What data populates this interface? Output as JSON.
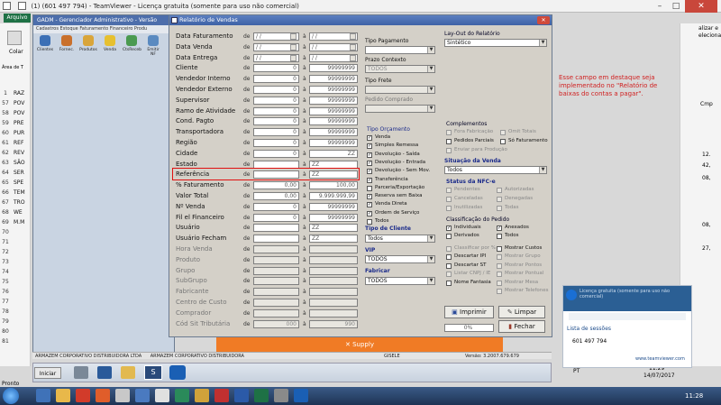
{
  "teamviewer_title": "(1) (601 497 794) - TeamViewer - Licença gratuita (somente para uso não comercial)",
  "excel": {
    "tab": "Arquivo",
    "left_labels": [
      "Colar",
      "Área de T"
    ],
    "row_numbers": [
      "1",
      "57",
      "58",
      "59",
      "60",
      "61",
      "62",
      "63",
      "64",
      "65",
      "66",
      "67",
      "68",
      "69",
      "70",
      "71",
      "72",
      "73",
      "74",
      "75",
      "76",
      "77",
      "78",
      "79",
      "80",
      "81"
    ],
    "row_texts": [
      "RAZ",
      "POV",
      "POV",
      "PRE",
      "PUR",
      "REF",
      "REV",
      "SÃO",
      "SER",
      "SPE",
      "TEM",
      "TRO",
      "WE",
      "M.M"
    ],
    "right_labels": [
      "alizar e",
      "elecionar",
      "Cmp",
      "12.",
      "42,",
      "08,",
      "08,",
      "27,"
    ],
    "status": "Pronto"
  },
  "gadm": {
    "title": "GADM - Gerenciador Administrativo - Versão",
    "menu": "Cadastros  Estoque  Faturamento  Financeiro  Produ",
    "tools": [
      "Clientes",
      "Fornec.",
      "Produtos",
      "Venda",
      "CtsReceb",
      "Emitir NF"
    ],
    "status_company": "ARMAZEM CORPORATIVO DISTRIBUIDORA LTDA",
    "status_branch": "ARMAZEM CORPORATIVO DISTRIBUIDORA",
    "status_user": "GISELE",
    "status_version": "Versão: 3.2007.679.679"
  },
  "dialog": {
    "title": "Relatório de Vendas",
    "de": "de",
    "ate": "à",
    "filters": [
      {
        "label": "Data Faturamento",
        "from": "/ /",
        "to": "/ /",
        "type": "date",
        "enabled": true
      },
      {
        "label": "Data Venda",
        "from": "/ /",
        "to": "/ /",
        "type": "date",
        "enabled": true
      },
      {
        "label": "Data Entrega",
        "from": "/ /",
        "to": "/ /",
        "type": "date",
        "enabled": true
      },
      {
        "label": "Cliente",
        "from": "0",
        "to": "99999999",
        "type": "num",
        "enabled": true
      },
      {
        "label": "Vendedor Interno",
        "from": "0",
        "to": "99999999",
        "type": "num",
        "enabled": true
      },
      {
        "label": "Vendedor Externo",
        "from": "0",
        "to": "99999999",
        "type": "num",
        "enabled": true
      },
      {
        "label": "Supervisor",
        "from": "0",
        "to": "99999999",
        "type": "num",
        "enabled": true
      },
      {
        "label": "Ramo de Atividade",
        "from": "0",
        "to": "99999999",
        "type": "num",
        "enabled": true
      },
      {
        "label": "Cond. Pagto",
        "from": "0",
        "to": "99999999",
        "type": "num",
        "enabled": true
      },
      {
        "label": "Transportadora",
        "from": "0",
        "to": "99999999",
        "type": "num",
        "enabled": true
      },
      {
        "label": "Região",
        "from": "0",
        "to": "99999999",
        "type": "num",
        "enabled": true
      },
      {
        "label": "Cidade",
        "from": "0",
        "to": "ZZ",
        "type": "num",
        "enabled": true
      },
      {
        "label": "Estado",
        "from": "",
        "to": "ZZ",
        "type": "text",
        "enabled": true
      },
      {
        "label": "Referência",
        "from": "",
        "to": "ZZ",
        "type": "text",
        "enabled": true
      },
      {
        "label": "% Faturamento",
        "from": "0,00",
        "to": "100,00",
        "type": "num",
        "enabled": true
      },
      {
        "label": "Valor Total",
        "from": "0,00",
        "to": "9.999.999,99",
        "type": "num",
        "enabled": true
      },
      {
        "label": "Nº Venda",
        "from": "0",
        "to": "99999999",
        "type": "num",
        "enabled": true
      },
      {
        "label": "Fil el Financeiro",
        "from": "0",
        "to": "99999999",
        "type": "num",
        "enabled": true
      },
      {
        "label": "Usuário",
        "from": "",
        "to": "ZZ",
        "type": "text",
        "enabled": true
      },
      {
        "label": "Usuário Fecham",
        "from": "",
        "to": "ZZ",
        "type": "text",
        "enabled": true
      },
      {
        "label": "Hora Venda",
        "from": "",
        "to": "",
        "type": "text",
        "enabled": false
      },
      {
        "label": "Produto",
        "from": "",
        "to": "",
        "type": "num",
        "enabled": false
      },
      {
        "label": "Grupo",
        "from": "",
        "to": "",
        "type": "num",
        "enabled": false
      },
      {
        "label": "SubGrupo",
        "from": "",
        "to": "",
        "type": "num",
        "enabled": false
      },
      {
        "label": "Fabricante",
        "from": "",
        "to": "",
        "type": "num",
        "enabled": false
      },
      {
        "label": "Centro de Custo",
        "from": "",
        "to": "",
        "type": "num",
        "enabled": false
      },
      {
        "label": "Comprador",
        "from": "",
        "to": "",
        "type": "num",
        "enabled": false
      },
      {
        "label": "Cód Sit Tributária",
        "from": "000",
        "to": "990",
        "type": "num",
        "enabled": false
      }
    ],
    "mid": {
      "tipo_pagamento_label": "Tipo Pagamento",
      "prazo_label": "Prazo Contexto",
      "prazo_value": "TODOS",
      "tipo_frete_label": "Tipo Frete",
      "pedido_label": "Pedido Comprado",
      "tipo_orcamento_label": "Tipo Orçamento",
      "tipo_items": [
        {
          "label": "Venda",
          "checked": true
        },
        {
          "label": "Simples Remessa",
          "checked": true
        },
        {
          "label": "Devolução - Saída",
          "checked": true
        },
        {
          "label": "Devolução - Entrada",
          "checked": true
        },
        {
          "label": "Devolução - Sem Mov.",
          "checked": true
        },
        {
          "label": "Transferência",
          "checked": true
        },
        {
          "label": "Parceria/Exportação",
          "checked": false
        },
        {
          "label": "Reserva sem Baixa",
          "checked": true
        },
        {
          "label": "Venda Direta",
          "checked": true
        },
        {
          "label": "Ordem de Serviço",
          "checked": true
        },
        {
          "label": "Todos",
          "checked": false
        }
      ],
      "tipo_cliente_label": "Tipo de Cliente",
      "tipo_cliente_value": "Todos",
      "vip_label": "VIP",
      "vip_value": "TODOS",
      "fabricar_label": "Fabricar",
      "fabricar_value": "TODOS"
    },
    "right": {
      "layout_label": "Lay-Out do Relatório",
      "layout_value": "Sintético",
      "complementos_label": "Complementos",
      "complementos": [
        {
          "label": "Fora Fabricação",
          "checked": false,
          "enabled": false
        },
        {
          "label": "Omit Totais",
          "checked": false,
          "enabled": false
        },
        {
          "label": "Pedidos Parciais",
          "checked": false,
          "enabled": true
        },
        {
          "label": "Só Faturamento",
          "checked": false,
          "enabled": true
        },
        {
          "label": "Enviar para Produção",
          "checked": false,
          "enabled": false
        }
      ],
      "situacao_label": "Situação da Venda",
      "situacao_value": "Todos",
      "nfce_label": "Status da NFC-e",
      "nfce_items": [
        {
          "label": "Pendentes",
          "checked": false
        },
        {
          "label": "Autorizadas",
          "checked": false
        },
        {
          "label": "Canceladas",
          "checked": false
        },
        {
          "label": "Denegadas",
          "checked": false
        },
        {
          "label": "Inutilizadas",
          "checked": false
        },
        {
          "label": "Todas",
          "checked": false
        }
      ],
      "classif_label": "Classificação do Pedido",
      "classif_items": [
        {
          "label": "Individuais",
          "checked": true
        },
        {
          "label": "Anexados",
          "checked": true
        },
        {
          "label": "Derivados",
          "checked": false
        },
        {
          "label": "Todos",
          "checked": false
        }
      ],
      "opts_left": [
        {
          "label": "Classificar por %",
          "checked": false,
          "enabled": false
        },
        {
          "label": "Descartar IPI",
          "checked": false,
          "enabled": true
        },
        {
          "label": "Descartar ST",
          "checked": false,
          "enabled": true
        },
        {
          "label": "Listar CNPJ / IE",
          "checked": false,
          "enabled": false
        },
        {
          "label": "Nome Fantasia",
          "checked": false,
          "enabled": true
        }
      ],
      "opts_right": [
        {
          "label": "Mostrar Custos",
          "checked": false,
          "enabled": true
        },
        {
          "label": "Mostrar Grupo",
          "checked": false,
          "enabled": false
        },
        {
          "label": "Mostrar Pontos",
          "checked": false,
          "enabled": false
        },
        {
          "label": "Mostrar Pontual",
          "checked": false,
          "enabled": false
        },
        {
          "label": "Mostrar Mesa",
          "checked": false,
          "enabled": false
        },
        {
          "label": "Mostrar Telefones",
          "checked": false,
          "enabled": false
        }
      ],
      "imprimir_label": "Imprimir",
      "limpar_label": "Limpar",
      "progress_label": "0%",
      "progress_value": 0,
      "fechar_label": "Fechar"
    }
  },
  "note": "Esse campo em destaque seja implementado no \"Relatório de baixas do contas a pagar\".",
  "supply_text": "Supply",
  "teamviewer_panel": {
    "notif": "Licença gratuita (somente para uso não comercial)",
    "list_title": "Lista de sessões",
    "session_id": "601 497 794",
    "website": "www.teamviewer.com"
  },
  "inner_taskbar": {
    "start": "Iniciar",
    "lang": "PT",
    "time": "11:29",
    "date": "14/07/2017"
  },
  "outer_taskbar": {
    "time": "11:28"
  },
  "colors": {
    "accent_red": "#d02020",
    "title_blue": "#3e62a6",
    "supply_orange": "#f07b25"
  }
}
